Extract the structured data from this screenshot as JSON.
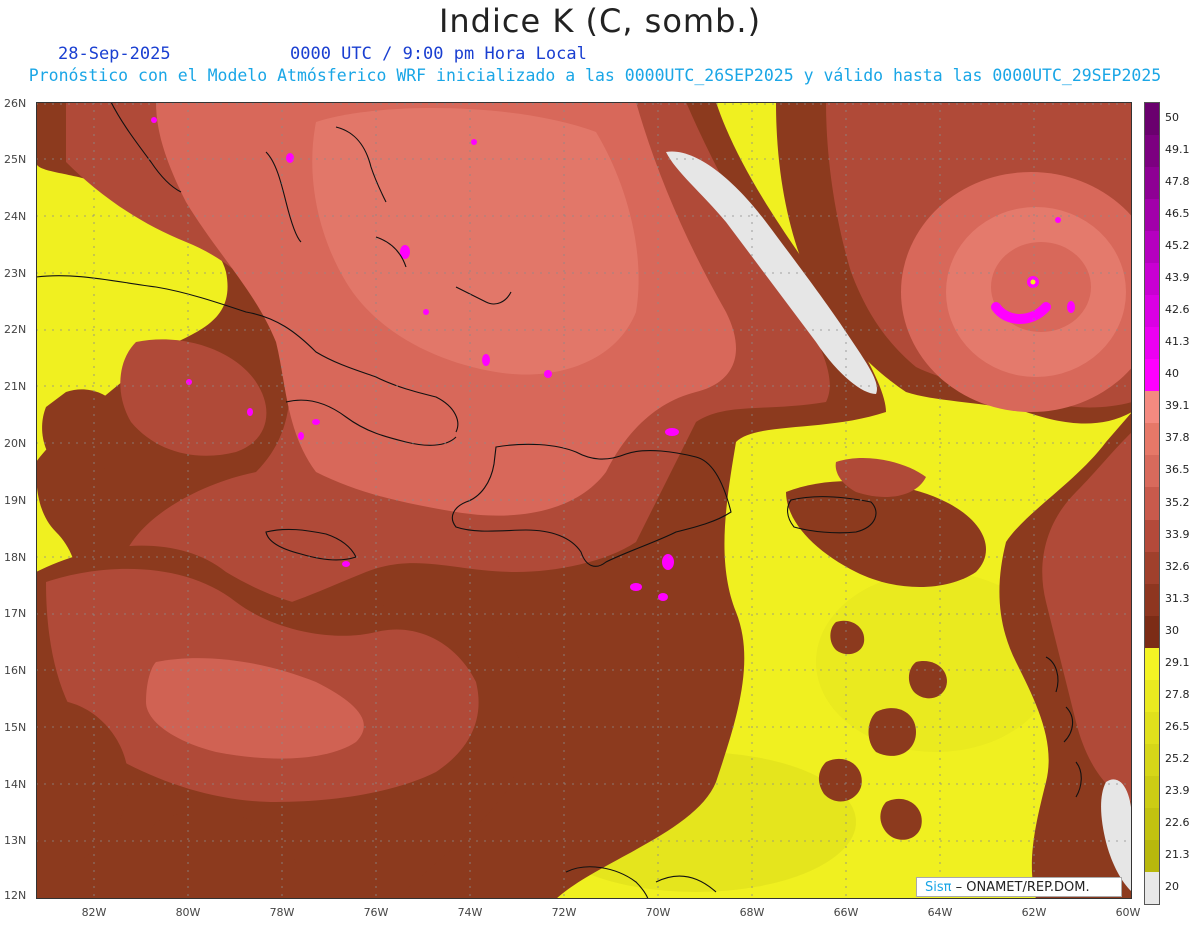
{
  "header": {
    "title": "Indice K (C, somb.)",
    "date": "28-Sep-2025",
    "time": "0000 UTC / 9:00 pm Hora Local",
    "subtitle": "Pronóstico con el Modelo Atmósferico WRF inicializado a las 0000UTC_26SEP2025 y válido hasta las  0000UTC_29SEP2025"
  },
  "map": {
    "lat_labels": [
      "26N",
      "25N",
      "24N",
      "23N",
      "22N",
      "21N",
      "20N",
      "19N",
      "18N",
      "17N",
      "16N",
      "15N",
      "14N",
      "13N",
      "12N"
    ],
    "lon_labels": [
      "82W",
      "80W",
      "78W",
      "76W",
      "74W",
      "72W",
      "70W",
      "68W",
      "66W",
      "64W",
      "62W",
      "60W"
    ],
    "colors": {
      "yellow": "#f0f020",
      "brown_dark": "#8c3a1e",
      "brown_mid": "#b04a38",
      "salmon": "#d8685a",
      "light_pink": "#e47a6c",
      "magenta": "#ff00ff",
      "gray": "#e6e6e6"
    }
  },
  "colorbar": {
    "labels": [
      "50",
      "49.1",
      "47.8",
      "46.5",
      "45.2",
      "43.9",
      "42.6",
      "41.3",
      "40",
      "39.1",
      "37.8",
      "36.5",
      "35.2",
      "33.9",
      "32.6",
      "31.3",
      "30",
      "29.1",
      "27.8",
      "26.5",
      "25.2",
      "23.9",
      "22.6",
      "21.3",
      "20"
    ],
    "colors": [
      "#6a006e",
      "#7c0080",
      "#8e0094",
      "#a200aa",
      "#b500bf",
      "#c800d2",
      "#da00e4",
      "#ec00f2",
      "#ff00ff",
      "#f48a80",
      "#e67868",
      "#d86a5c",
      "#c85a4c",
      "#b44a3a",
      "#a0402c",
      "#8e3620",
      "#7c2c16",
      "#f4f424",
      "#eaea20",
      "#e0e01c",
      "#d6d618",
      "#cccc14",
      "#c2c210",
      "#b8b80c",
      "#e8e8e8"
    ]
  },
  "credit": {
    "brand": "Sisπ",
    "org": "– ONAMET/REP.DOM."
  }
}
